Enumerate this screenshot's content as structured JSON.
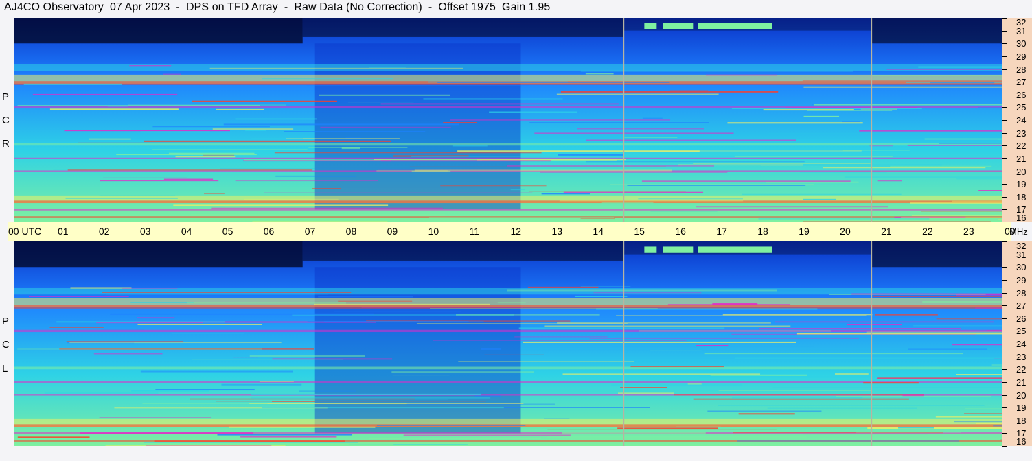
{
  "title": "AJ4CO Observatory  07 Apr 2023  -  DPS on TFD Array  -  Raw Data (No Correction)  -  Offset 1975  Gain 1.95",
  "chart_data": {
    "type": "heatmap",
    "title": "AJ4CO Observatory  07 Apr 2023  -  DPS on TFD Array  -  Raw Data (No Correction)  -  Offset 1975  Gain 1.95",
    "x_axis": {
      "unit": "UTC",
      "range": [
        0,
        24
      ],
      "tick_labels": [
        "00  UTC",
        "01",
        "02",
        "03",
        "04",
        "05",
        "06",
        "07",
        "08",
        "09",
        "10",
        "11",
        "12",
        "13",
        "14",
        "15",
        "16",
        "17",
        "18",
        "19",
        "20",
        "21",
        "22",
        "23",
        "00"
      ]
    },
    "y_axis": {
      "unit": "MHz",
      "range": [
        16,
        32
      ],
      "tick_labels": [
        "32",
        "31",
        "30",
        "29",
        "28",
        "27",
        "26",
        "25",
        "24",
        "23",
        "22",
        "21",
        "20",
        "19",
        "18",
        "17",
        "16"
      ]
    },
    "panels": [
      {
        "polarization": [
          "R",
          "C",
          "P"
        ]
      },
      {
        "polarization": [
          "L",
          "C",
          "P"
        ]
      }
    ],
    "vertical_markers_utc": [
      14.78,
      20.8
    ],
    "color_scale": [
      "#000014",
      "#0a32c8",
      "#1e82ff",
      "#2ed2e6",
      "#7ff0a0",
      "#f0f064",
      "#ff3c28",
      "#e628c8"
    ]
  }
}
